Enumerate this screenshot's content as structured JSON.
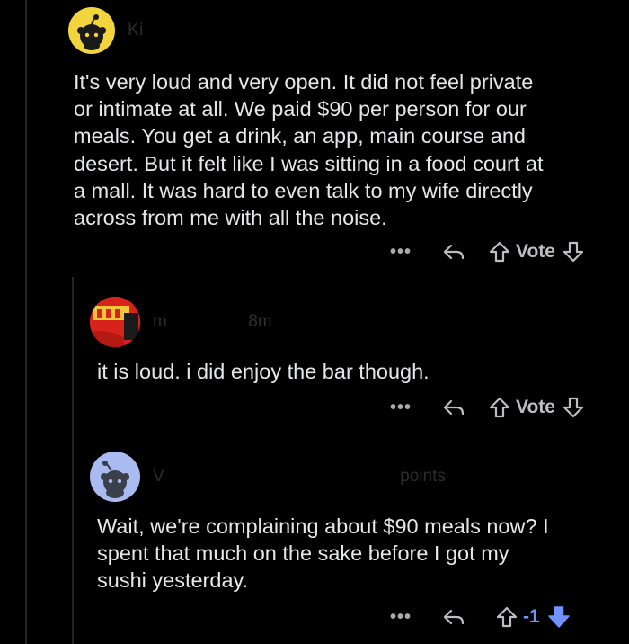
{
  "comments": [
    {
      "username": "Ki",
      "meta": "",
      "avatar": "snoo-avatar",
      "avatar_bg": "#f2d53c",
      "body": "It's very loud and very open. It did not feel private\nor intimate at all. We paid $90 per person for our\nmeals. You get a drink, an app, main course and\ndesert. But it felt like I was sitting in a food court at\na mall. It was hard to even talk to my wife directly\nacross from me with all the noise.",
      "more_label": "•••",
      "vote_label": "Vote"
    },
    {
      "username": "m",
      "meta": "8m",
      "avatar": "photo-avatar",
      "avatar_bg": "#d8231c",
      "body": "it is loud.  i did enjoy the bar though.",
      "more_label": "•••",
      "vote_label": "Vote"
    },
    {
      "username": "V",
      "meta": "points",
      "avatar": "snoo-avatar",
      "avatar_bg": "#a9bbf0",
      "body": "Wait, we're complaining about $90 meals now? I\nspent that much on the sake before I got my\nsushi yesterday.",
      "more_label": "•••",
      "score": "-1",
      "downvote_color": "#7193ff"
    }
  ]
}
